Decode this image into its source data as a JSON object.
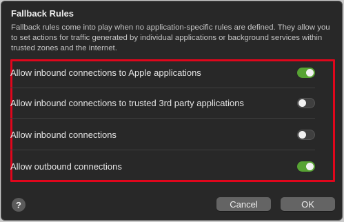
{
  "dialog": {
    "title": "Fallback Rules",
    "description": "Fallback rules come into play when no application-specific rules are defined. They allow you to set actions for traffic generated by individual applications or background services within trusted zones and the internet."
  },
  "rules": [
    {
      "label": "Allow inbound connections to Apple applications",
      "enabled": true
    },
    {
      "label": "Allow inbound connections to trusted 3rd party applications",
      "enabled": false
    },
    {
      "label": "Allow inbound connections",
      "enabled": false
    },
    {
      "label": "Allow outbound connections",
      "enabled": true
    }
  ],
  "buttons": {
    "help": "?",
    "cancel": "Cancel",
    "ok": "OK"
  },
  "colors": {
    "toggle_on": "#57a333",
    "highlight_border": "#e0061c",
    "dialog_bg": "#282828"
  }
}
